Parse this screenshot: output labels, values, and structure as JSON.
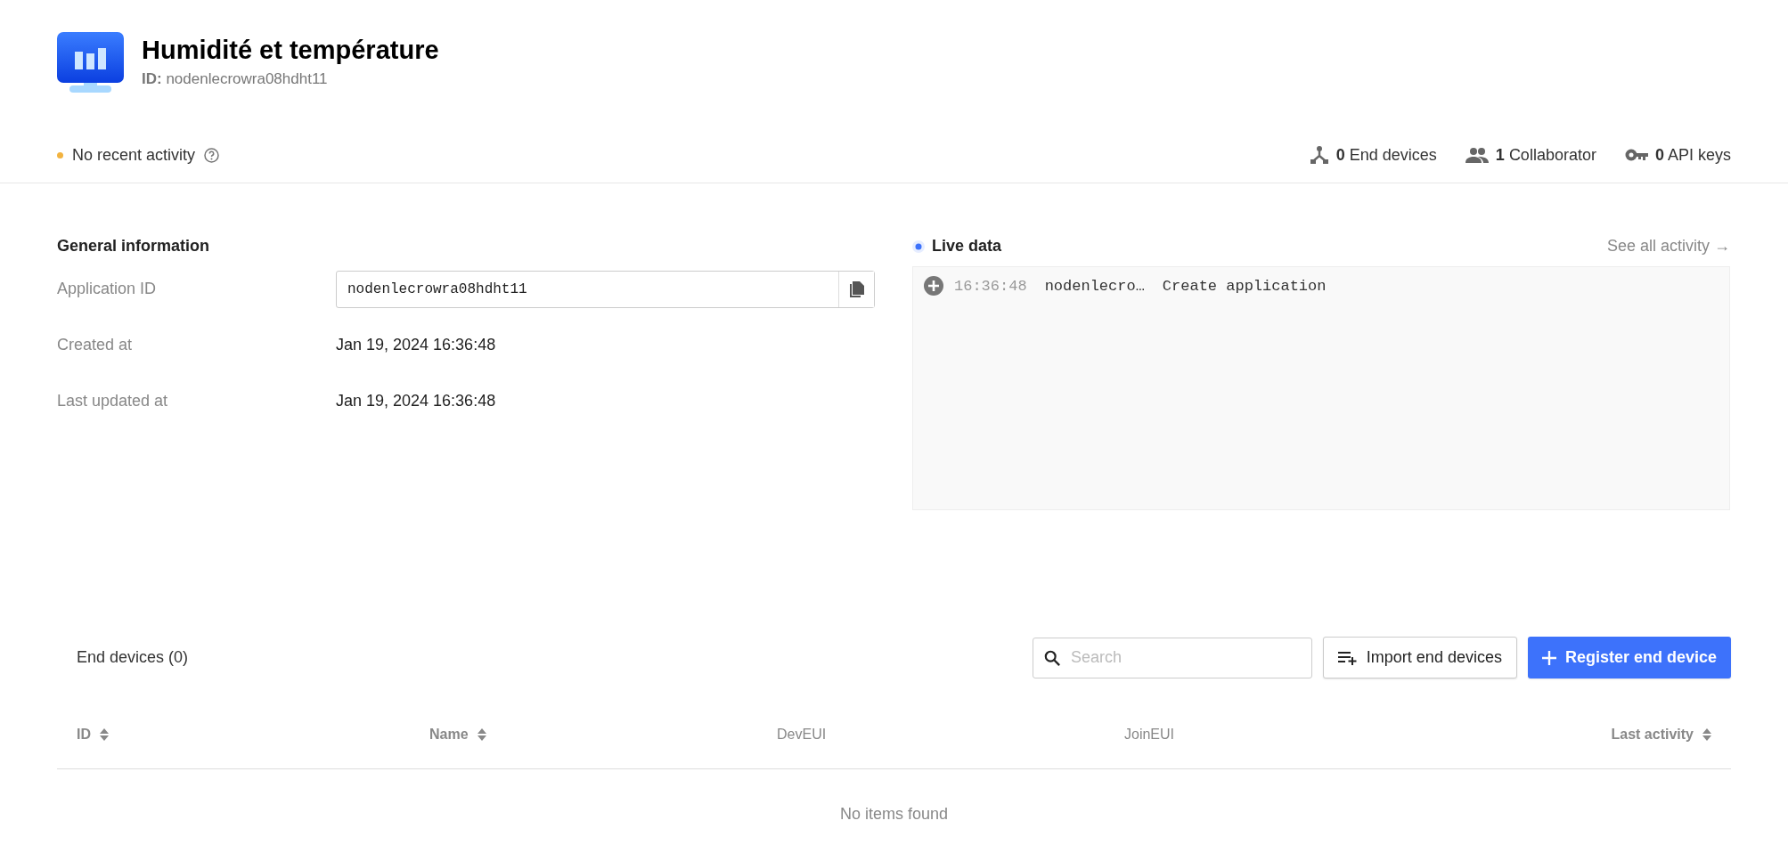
{
  "header": {
    "title": "Humidité et température",
    "id_label": "ID:",
    "id_value": "nodenlecrowra08hdht11"
  },
  "status": {
    "text": "No recent activity",
    "color": "#f2b340"
  },
  "stats": [
    {
      "kind": "devices",
      "count": "0",
      "label": "End devices"
    },
    {
      "kind": "collaborators",
      "count": "1",
      "label": "Collaborator"
    },
    {
      "kind": "keys",
      "count": "0",
      "label": "API keys"
    }
  ],
  "general": {
    "title": "General information",
    "rows": [
      {
        "kind": "field",
        "label": "Application ID",
        "value": "nodenlecrowra08hdht11"
      },
      {
        "kind": "text",
        "label": "Created at",
        "value": "Jan 19, 2024 16:36:48"
      },
      {
        "kind": "text",
        "label": "Last updated at",
        "value": "Jan 19, 2024 16:36:48"
      }
    ]
  },
  "live_data": {
    "title": "Live data",
    "link": "See all activity →",
    "events": [
      {
        "time": "16:36:48",
        "entity": "nodenlecro…",
        "message": "Create application"
      }
    ]
  },
  "end_devices": {
    "title": "End devices (0)",
    "search": {
      "placeholder": "Search"
    },
    "import_button": "Import end devices",
    "register_button": "Register end device",
    "columns": [
      {
        "label": "ID",
        "sortable": true
      },
      {
        "label": "Name",
        "sortable": true
      },
      {
        "label": "DevEUI",
        "sortable": false
      },
      {
        "label": "JoinEUI",
        "sortable": false
      },
      {
        "label": "Last activity",
        "sortable": true
      }
    ],
    "empty": "No items found"
  }
}
